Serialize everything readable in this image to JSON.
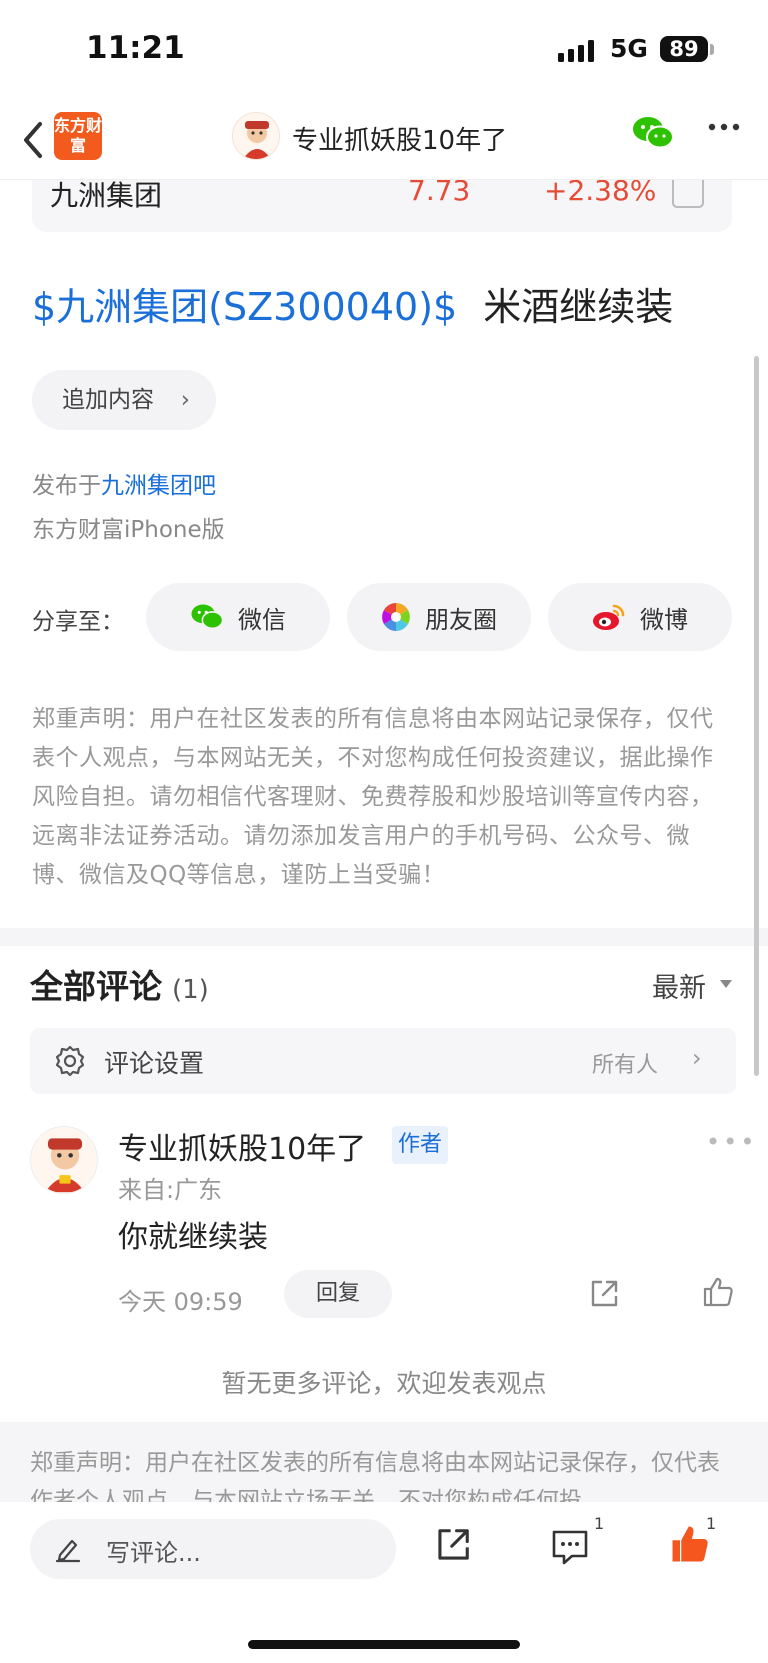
{
  "status_bar": {
    "time": "11:21",
    "network": "5G",
    "battery": "89"
  },
  "nav": {
    "app_logo": "东方财富",
    "title": "专业抓妖股10年了"
  },
  "stock": {
    "name": "九洲集团",
    "price": "7.73",
    "change": "+2.38%"
  },
  "post": {
    "tag": "$九洲集团(SZ300040)$",
    "text": "米酒继续装"
  },
  "add_content": "追加内容",
  "published_in": {
    "prefix": "发布于",
    "bar": "九洲集团吧"
  },
  "client": "东方财富iPhone版",
  "share": {
    "label": "分享至：",
    "wechat": "微信",
    "moments": "朋友圈",
    "weibo": "微博"
  },
  "disclaimer": "郑重声明：用户在社区发表的所有信息将由本网站记录保存，仅代表个人观点，与本网站无关，不对您构成任何投资建议，据此操作风险自担。请勿相信代客理财、免费荐股和炒股培训等宣传内容，远离非法证券活动。请勿添加发言用户的手机号码、公众号、微博、微信及QQ等信息，谨防上当受骗！",
  "comments": {
    "title": "全部评论",
    "count": "(1)",
    "sort": "最新",
    "settings_label": "评论设置",
    "settings_value": "所有人",
    "items": [
      {
        "author": "专业抓妖股10年了",
        "badge": "作者",
        "location": "来自:广东",
        "content": "你就继续装",
        "time": "今天 09:59",
        "reply": "回复"
      }
    ],
    "no_more": "暂无更多评论，欢迎发表观点"
  },
  "footer_disclaimer": "郑重声明：用户在社区发表的所有信息将由本网站记录保存，仅代表作者个人观点，与本网站立场无关，不对您构成任何投",
  "bottom_bar": {
    "write_placeholder": "写评论...",
    "comment_count": "1",
    "like_count": "1"
  },
  "colors": {
    "link_blue": "#1a6fd8",
    "up_red": "#e64b35",
    "brand_orange": "#f25a1e",
    "like_orange": "#f5561e"
  }
}
